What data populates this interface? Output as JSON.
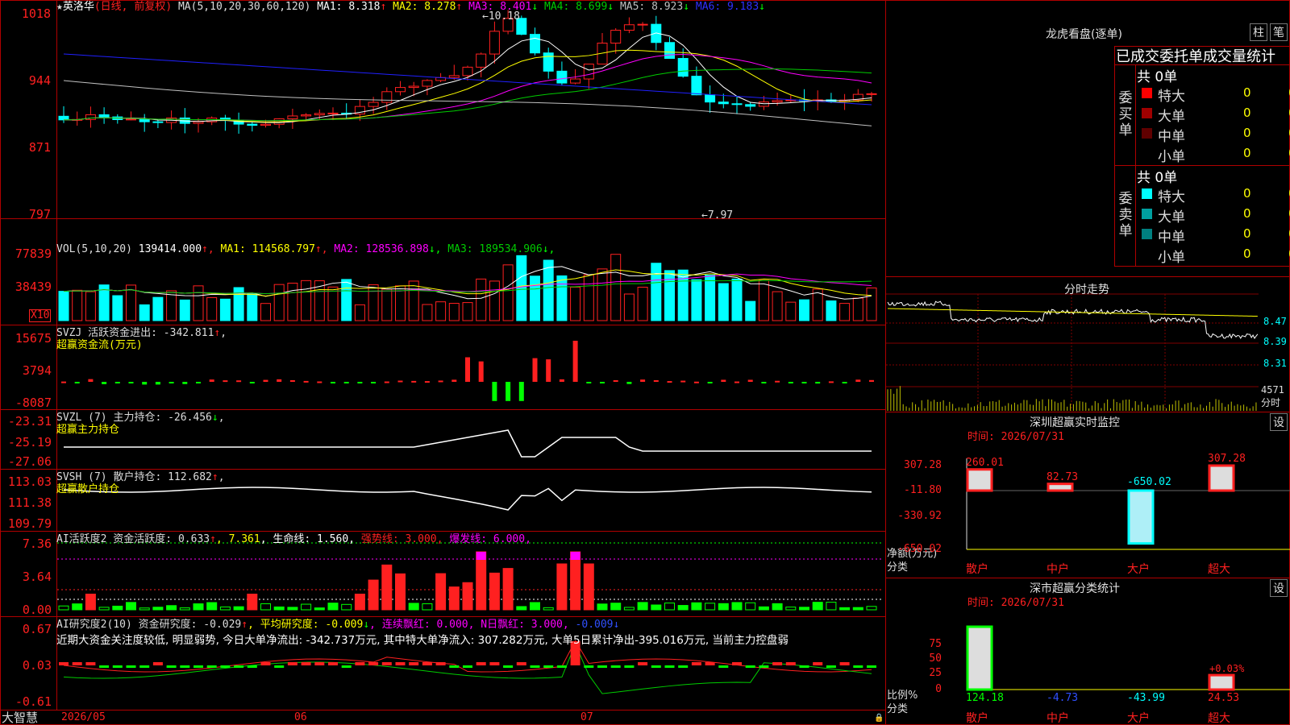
{
  "colors": {
    "up": "#ff2020",
    "down": "#00ffff",
    "red_line": "#c00000",
    "ma1": "#ffffff",
    "ma2": "#ffff00",
    "ma3": "#ff00ff",
    "ma4": "#00cc00",
    "ma5": "#a0a0a0",
    "ma6": "#2020ff",
    "label": "#ffff00",
    "green_bar": "#00ff00"
  },
  "stock": {
    "name": "英洛华",
    "period": "(日线, 前复权)"
  },
  "main_panel": {
    "ma_prefix": "MA(5,10,20,30,60,120)",
    "ma_values": [
      {
        "label": "MA1: 8.318",
        "arrow": "↑",
        "color": "#ffffff"
      },
      {
        "label": "MA2: 8.278",
        "arrow": "↑",
        "color": "#ffff00"
      },
      {
        "label": "MA3: 8.401",
        "arrow": "↓",
        "color": "#ff00ff"
      },
      {
        "label": "MA4: 8.699",
        "arrow": "↓",
        "color": "#00cc00"
      },
      {
        "label": "MA5: 8.923",
        "arrow": "↓",
        "color": "#c0c0c0"
      },
      {
        "label": "MA6: 9.183",
        "arrow": "↓",
        "color": "#3030ff"
      }
    ],
    "y_ticks": [
      "1018",
      "944",
      "871",
      "797"
    ],
    "high_marker": "←10.18",
    "low_marker": "←7.97"
  },
  "vol_panel": {
    "prefix": "VOL(5,10,20)",
    "values": [
      {
        "label": "139414.000",
        "arrow": "↑",
        "color": "#ffffff"
      },
      {
        "label": "MA1: 114568.797",
        "arrow": "↑",
        "color": "#ffff00"
      },
      {
        "label": "MA2: 128536.898",
        "arrow": "↓",
        "color": "#ff00ff"
      },
      {
        "label": "MA3: 189534.906",
        "arrow": "↓",
        "color": "#00cc00"
      }
    ],
    "y_ticks": [
      "77839",
      "38439"
    ],
    "unit": "X10"
  },
  "svzj_panel": {
    "title": "SVZJ  活跃资金进出: -342.811",
    "arrow": "↑",
    "sub": "超赢资金流(万元)",
    "y_ticks": [
      "15675",
      "3794",
      "-8087"
    ]
  },
  "svzl_panel": {
    "title": "SVZL (7) 主力持仓: -26.456",
    "arrow": "↓",
    "sub": "超赢主力持仓",
    "y_ticks": [
      "-23.31",
      "-25.19",
      "-27.06"
    ]
  },
  "svsh_panel": {
    "title": "SVSH (7) 散户持仓: 112.682",
    "arrow": "↑",
    "sub": "超赢散户持仓",
    "y_ticks": [
      "113.03",
      "111.38",
      "109.79"
    ]
  },
  "ai_active": {
    "title": "AI活跃度2 资金活跃度: 0.633",
    "title_arrow": "↑",
    "v2": ", 7.361",
    "v3": ", 生命线: 1.560,",
    "v4": " 强势线: 3.000,",
    "v5": " 爆发线: 6.000,",
    "y_ticks": [
      "7.36",
      "3.64",
      "0.00"
    ]
  },
  "ai_research": {
    "title": "AI研究度2(10) 资金研究度: -0.029",
    "t_arrow": "↑",
    "p2": ", 平均研究度: -0.009",
    "p2_arrow": "↓",
    "p3": ", 连续飘红: 0.000, N日飘红: 3.000,",
    "p4": " -0.009",
    "p4_arrow": "↓",
    "sentence": "近期大资金关注度较低, 明显弱势, 今日大单净流出: -342.737万元, 其中特大单净流入: 307.282万元, 大单5日累计净出-395.016万元, 当前主力控盘弱",
    "y_ticks": [
      "0.67",
      "0.03",
      "-0.61"
    ]
  },
  "x_axis": {
    "brand": "大智慧",
    "labels": [
      "2026/05",
      "06",
      "07"
    ]
  },
  "dragon_tiger": {
    "title": "龙虎看盘(逐单)",
    "btn1": "柱",
    "btn2": "笔",
    "header": "已成交委托单成交量统计",
    "buy": {
      "side": "委买单",
      "total": "共 0单",
      "rows": [
        {
          "name": "特大",
          "count": "0",
          "pct": "0%",
          "color": "#ff0000"
        },
        {
          "name": "大单",
          "count": "0",
          "pct": "0%",
          "color": "#a00000"
        },
        {
          "name": "中单",
          "count": "0",
          "pct": "0%",
          "color": "#600000"
        },
        {
          "name": "小单",
          "count": "0",
          "pct": "0%",
          "color": "#000000"
        }
      ]
    },
    "sell": {
      "side": "委卖单",
      "total": "共 0单",
      "rows": [
        {
          "name": "特大",
          "count": "0",
          "pct": "0%",
          "color": "#00ffff"
        },
        {
          "name": "大单",
          "count": "0",
          "pct": "0%",
          "color": "#00a0a0"
        },
        {
          "name": "中单",
          "count": "0",
          "pct": "0%",
          "color": "#008080"
        },
        {
          "name": "小单",
          "count": "0",
          "pct": "0%",
          "color": "#000000"
        }
      ]
    }
  },
  "intraday": {
    "title": "分时走势",
    "price_ticks": [
      "8.47",
      "8.39",
      "8.31"
    ],
    "vol_tick": "4571",
    "vol_unit": "分时"
  },
  "sz_monitor": {
    "title": "深圳超赢实时监控",
    "btn": "设",
    "date": "时间: 2026/07/31",
    "y_ticks": [
      "307.28",
      "-11.80",
      "-330.92",
      "-650.02"
    ],
    "y_label": "净额(万元)",
    "x_label": "分类",
    "bars": [
      {
        "cat": "散户",
        "value": 260.01,
        "label": "260.01"
      },
      {
        "cat": "中户",
        "value": 82.73,
        "label": "82.73"
      },
      {
        "cat": "大户",
        "value": -650.02,
        "label": "-650.02"
      },
      {
        "cat": "超大",
        "value": 307.28,
        "label": "307.28"
      }
    ]
  },
  "sz_class": {
    "title": "深市超赢分类统计",
    "btn": "设",
    "date": "时间: 2026/07/31",
    "y_ticks": [
      "75",
      "50",
      "25",
      "0"
    ],
    "y_label": "比例%",
    "x_label": "分类",
    "bars": [
      {
        "cat": "散户",
        "value": 124.18,
        "label": "124.18"
      },
      {
        "cat": "中户",
        "value": -4.73,
        "label": "-4.73"
      },
      {
        "cat": "大户",
        "value": -43.99,
        "label": "-43.99"
      },
      {
        "cat": "超大",
        "value": 24.53,
        "label": "24.53"
      }
    ],
    "extra_label": "+0.03%"
  }
}
